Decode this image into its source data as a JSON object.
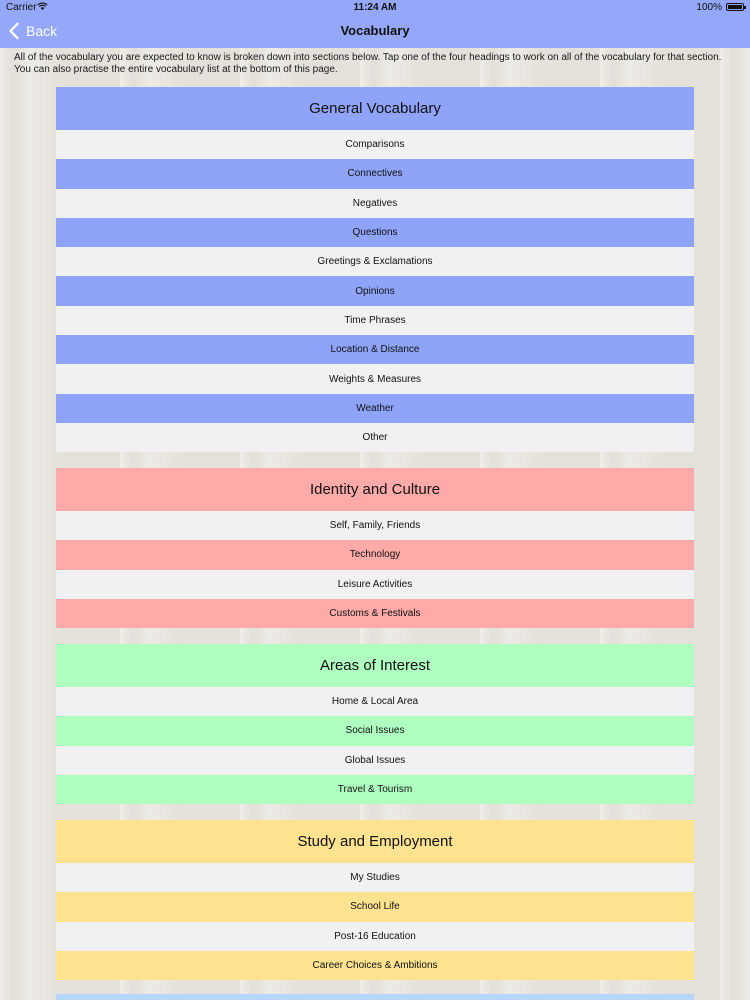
{
  "status_bar": {
    "carrier": "Carrier",
    "time": "11:24 AM",
    "battery": "100%"
  },
  "nav": {
    "back_label": "Back",
    "title": "Vocabulary"
  },
  "intro": "All of the vocabulary you are expected to know is broken down into sections below.  Tap one of the four headings to work on all of the vocabulary for that section. You can also practise the entire vocabulary list at the bottom of this page.",
  "colors": {
    "nav_bar": "#94a7f8",
    "general": "#8fa3f9",
    "identity": "#fdaaa9",
    "interest": "#afffc1",
    "study": "#fde28f",
    "alt_row": "#f1f1f3"
  },
  "sections": [
    {
      "heading": "General Vocabulary",
      "items": [
        "Comparisons",
        "Connectives",
        "Negatives",
        "Questions",
        "Greetings & Exclamations",
        "Opinions",
        "Time Phrases",
        "Location & Distance",
        "Weights & Measures",
        "Weather",
        "Other"
      ]
    },
    {
      "heading": "Identity and Culture",
      "items": [
        "Self, Family, Friends",
        "Technology",
        "Leisure Activities",
        "Customs & Festivals"
      ]
    },
    {
      "heading": "Areas of Interest",
      "items": [
        "Home & Local Area",
        "Social Issues",
        "Global Issues",
        "Travel & Tourism"
      ]
    },
    {
      "heading": "Study and Employment",
      "items": [
        "My Studies",
        "School Life",
        "Post-16 Education",
        "Career Choices & Ambitions"
      ]
    }
  ]
}
